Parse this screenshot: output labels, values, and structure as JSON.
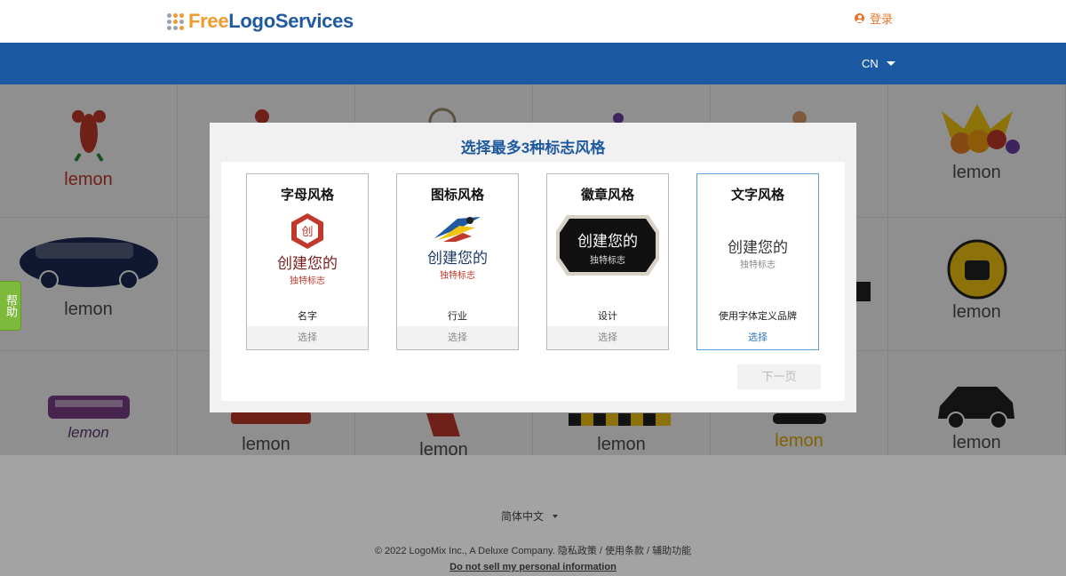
{
  "header": {
    "logo": {
      "part1": "Free",
      "part2": "LogoServices"
    },
    "login_label": "登录",
    "login_icon": "user-icon"
  },
  "navbar": {
    "language": "CN"
  },
  "help_tab": {
    "label": "帮助"
  },
  "background_grid": {
    "labels": [
      "lemon",
      "lemon",
      "lemon",
      "lemon",
      "lemon",
      "lemon",
      "lemon",
      "lemon",
      "lemon",
      "lemon"
    ]
  },
  "modal": {
    "title": "选择最多3种标志风格",
    "cards": [
      {
        "title": "字母风格",
        "preview_main": "创建您的",
        "preview_sub": "独特标志",
        "preview_badge_char": "创",
        "description": "名字",
        "select_label": "选择"
      },
      {
        "title": "图标风格",
        "preview_main": "创建您的",
        "preview_sub": "独特标志",
        "description": "行业",
        "select_label": "选择"
      },
      {
        "title": "徽章风格",
        "preview_main": "创建您的",
        "preview_sub": "独特标志",
        "description": "设计",
        "select_label": "选择"
      },
      {
        "title": "文字风格",
        "preview_main": "创建您的",
        "preview_sub": "独特标志",
        "description": "使用字体定义品牌",
        "select_label": "选择"
      }
    ],
    "next_label": "下一页"
  },
  "footer": {
    "language": "简体中文",
    "copyright": "© 2022 LogoMix Inc., A Deluxe Company. 隐私政策 / 使用条款 / 辅助功能",
    "do_not_sell": "Do not sell my personal information"
  },
  "colors": {
    "brand_blue": "#1b5aa3",
    "brand_orange": "#f29a2e",
    "help_green": "#7dba3b",
    "select_blue": "#2b78c2"
  }
}
